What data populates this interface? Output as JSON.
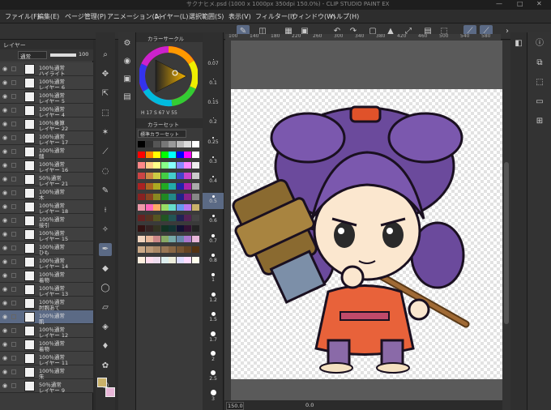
{
  "titlebar": {
    "title": "サクナヒメ.psd (1000 x 1000px 350dpi 150.0%) - CLIP STUDIO PAINT EX",
    "min": "—",
    "max": "□",
    "close": "✕"
  },
  "menu": [
    "ファイル(F)",
    "編集(E)",
    "ページ管理(P)",
    "アニメーション(A)",
    "レイヤー(L)",
    "選択範囲(S)",
    "表示(V)",
    "フィルター(I)",
    "ウィンドウ(W)",
    "ヘルプ(H)"
  ],
  "ruler_ticks": [
    "100",
    "140",
    "180",
    "220",
    "260",
    "300",
    "340",
    "380",
    "420",
    "460",
    "500",
    "540",
    "580"
  ],
  "layer_panel": {
    "title": "レイヤー",
    "blend": "通常",
    "opacity": "100",
    "layers": [
      {
        "l1": "100％通常",
        "l2": "ハイライト"
      },
      {
        "l1": "100％通常",
        "l2": "レイヤー 6"
      },
      {
        "l1": "100％通常",
        "l2": "レイヤー 5"
      },
      {
        "l1": "100％通常",
        "l2": "レイヤー 4"
      },
      {
        "l1": "100％乗算",
        "l2": "レイヤー 22"
      },
      {
        "l1": "100％通常",
        "l2": "レイヤー 17"
      },
      {
        "l1": "100％通常",
        "l2": "鎚"
      },
      {
        "l1": "100％通常",
        "l2": "レイヤー 16"
      },
      {
        "l1": "50％通常",
        "l2": "レイヤー 21"
      },
      {
        "l1": "100％通常",
        "l2": "木"
      },
      {
        "l1": "100％通常",
        "l2": "レイヤー 18"
      },
      {
        "l1": "100％通常",
        "l2": "接引"
      },
      {
        "l1": "100％通常",
        "l2": "レイヤー 15"
      },
      {
        "l1": "100％通常",
        "l2": "ひも"
      },
      {
        "l1": "100％通常",
        "l2": "レイヤー 14"
      },
      {
        "l1": "100％通常",
        "l2": "着物"
      },
      {
        "l1": "100％通常",
        "l2": "レイヤー 13"
      },
      {
        "l1": "100％通常",
        "l2": "肘腕あて"
      },
      {
        "l1": "100％通常",
        "l2": "肌"
      },
      {
        "l1": "100％通常",
        "l2": "レイヤー 12"
      },
      {
        "l1": "100％通常",
        "l2": "着物"
      },
      {
        "l1": "100％通常",
        "l2": "レイヤー 11"
      },
      {
        "l1": "100％通常",
        "l2": "朱"
      },
      {
        "l1": "50％通常",
        "l2": "レイヤー 9"
      }
    ],
    "selected_index": 18
  },
  "color_wheel": {
    "title": "カラーサークル",
    "values": "H 17  S 67  V 55"
  },
  "color_set": {
    "title": "カラーセット",
    "select": "標準カラーセット"
  },
  "brush_sizes": [
    "0.07",
    "0.1",
    "0.15",
    "0.2",
    "0.25",
    "0.3",
    "0.4",
    "0.5",
    "0.6",
    "0.7",
    "0.8",
    "1",
    "1.2",
    "1.5",
    "1.7",
    "2",
    "2.5",
    "3"
  ],
  "brush_size_selected": "0.5",
  "status": {
    "zoom": "150.0",
    "angle": "0.0"
  },
  "colors": {
    "accent": "#5b6a85",
    "main_color": "#c9b16a",
    "sub_color": "#e8b7d8"
  },
  "icons": {
    "tools": [
      "zoom-icon",
      "move-icon",
      "operation-icon",
      "selection-icon",
      "magic-wand-icon",
      "eyedropper-icon",
      "pen-icon",
      "pencil-icon",
      "brush-icon",
      "airbrush-icon",
      "decoration-icon",
      "eraser-icon",
      "blend-icon",
      "fill-icon",
      "gradient-icon",
      "figure-icon",
      "text-icon",
      "balloon-icon"
    ]
  }
}
